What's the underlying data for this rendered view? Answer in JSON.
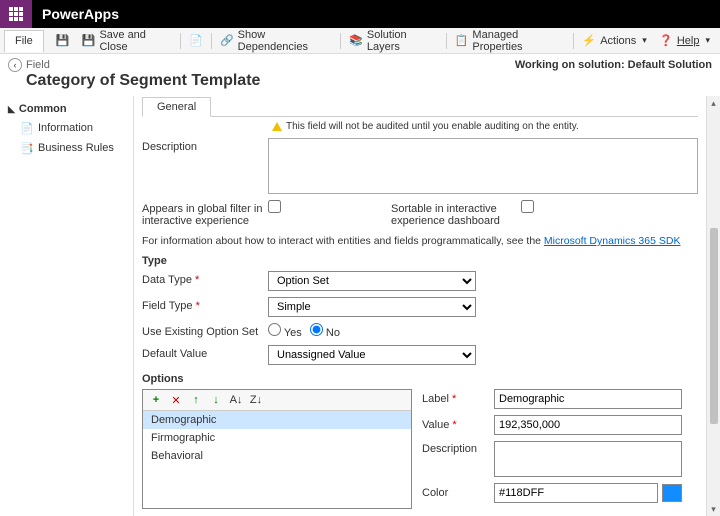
{
  "brand": "PowerApps",
  "cmdbar": {
    "file": "File",
    "save_close": "Save and Close",
    "show_deps": "Show Dependencies",
    "solution_layers": "Solution Layers",
    "managed_props": "Managed Properties",
    "actions": "Actions",
    "help": "Help"
  },
  "context": {
    "crumb": "Field",
    "right_label": "Working on solution:",
    "right_value": "Default Solution",
    "title": "Category of Segment Template"
  },
  "nav": {
    "header": "Common",
    "info": "Information",
    "rules": "Business Rules"
  },
  "tab_general": "General",
  "warn_text": "This field will not be audited until you enable auditing on the entity.",
  "form": {
    "description": "Description",
    "appears_filter": "Appears in global filter in interactive experience",
    "sortable": "Sortable in interactive experience dashboard",
    "info_prefix": "For information about how to interact with entities and fields programmatically, see the ",
    "info_link": "Microsoft Dynamics 365 SDK",
    "type_header": "Type",
    "data_type": "Data Type",
    "data_type_val": "Option Set",
    "field_type": "Field Type",
    "field_type_val": "Simple",
    "use_existing": "Use Existing Option Set",
    "yes": "Yes",
    "no": "No",
    "default_value": "Default Value",
    "default_value_val": "Unassigned Value",
    "options_header": "Options",
    "options": [
      "Demographic",
      "Firmographic",
      "Behavioral"
    ],
    "detail": {
      "label": "Label",
      "label_val": "Demographic",
      "value": "Value",
      "value_val": "192,350,000",
      "description": "Description",
      "description_val": "",
      "color": "Color",
      "color_val": "#118DFF"
    }
  }
}
